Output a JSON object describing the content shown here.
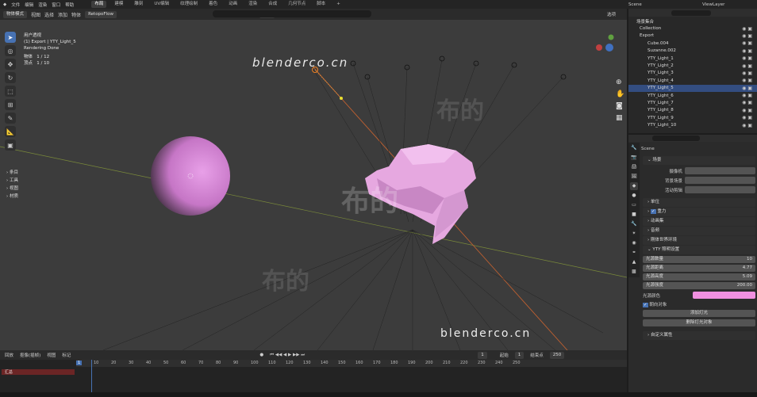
{
  "topbar": {
    "menus": [
      "文件",
      "编辑",
      "渲染",
      "窗口",
      "帮助"
    ],
    "workspaces": [
      "布局",
      "建模",
      "雕刻",
      "UV编辑",
      "纹理绘制",
      "着色",
      "动画",
      "渲染",
      "合成",
      "几何节点",
      "脚本"
    ],
    "active_workspace": "布局",
    "scene": "Scene",
    "view_layer": "ViewLayer"
  },
  "viewport_header": {
    "mode": "物体模式",
    "menus": [
      "视图",
      "选择",
      "添加",
      "物体"
    ],
    "addon": "RetopoFlow",
    "transform": "全局",
    "options": "选项"
  },
  "overlay_info": {
    "line1": "用户透视",
    "line2": "(1) Export | YTY_Light_5",
    "line3": "Rendering Done",
    "objects_label": "物体",
    "objects_value": "1 / 12",
    "verts_label": "顶点",
    "verts_value": "1 / 10"
  },
  "side_tabs": [
    "条目",
    "工具",
    "视图",
    "材质"
  ],
  "watermarks": {
    "site": "blenderco.cn",
    "cn": "布的"
  },
  "outliner": {
    "title": "场景集合",
    "rows": [
      {
        "label": "Collection",
        "indent": 0
      },
      {
        "label": "Export",
        "indent": 0
      },
      {
        "label": "Cube.004",
        "indent": 1
      },
      {
        "label": "Suzanne.002",
        "indent": 1
      },
      {
        "label": "YTY_Light_1",
        "indent": 1
      },
      {
        "label": "YTY_Light_2",
        "indent": 1
      },
      {
        "label": "YTY_Light_3",
        "indent": 1
      },
      {
        "label": "YTY_Light_4",
        "indent": 1
      },
      {
        "label": "YTY_Light_5",
        "indent": 1,
        "selected": true
      },
      {
        "label": "YTY_Light_6",
        "indent": 1
      },
      {
        "label": "YTY_Light_7",
        "indent": 1
      },
      {
        "label": "YTY_Light_8",
        "indent": 1
      },
      {
        "label": "YTY_Light_9",
        "indent": 1
      },
      {
        "label": "YTY_Light_10",
        "indent": 1
      }
    ]
  },
  "properties": {
    "scene_name": "Scene",
    "scene_section": "场景",
    "camera_label": "摄像机",
    "bg_scene_label": "背景场景",
    "active_clip_label": "活动剪辑",
    "sections": [
      "单位",
      "重力",
      "动画集",
      "音频",
      "刚体世界环境"
    ],
    "gravity_checked": true,
    "yty_panel": "YTY 照明设置",
    "fields": [
      {
        "label": "光源数量",
        "value": "10"
      },
      {
        "label": "光源距离",
        "value": "4.77"
      },
      {
        "label": "光源高度",
        "value": "5.09"
      },
      {
        "label": "光源强度",
        "value": "200.00"
      }
    ],
    "color_label": "光源颜色",
    "light_color": "#f090e0",
    "rotate_checkbox": "朝向对象",
    "rotate_checked": true,
    "btn_add": "添加灯光",
    "btn_remove": "删除灯光对象",
    "custom_props": "自定义属性"
  },
  "timeline": {
    "menus": [
      "回放",
      "抠像(插帧)",
      "视图",
      "标记"
    ],
    "current_frame": "1",
    "start_label": "起始",
    "start": "1",
    "end_label": "结束点",
    "end": "250",
    "ticks": [
      "1",
      "10",
      "20",
      "30",
      "40",
      "50",
      "60",
      "70",
      "80",
      "90",
      "100",
      "110",
      "120",
      "130",
      "140",
      "150",
      "160",
      "170",
      "180",
      "190",
      "200",
      "210",
      "220",
      "230",
      "240",
      "250"
    ],
    "track": "汇总"
  },
  "colors": {
    "accent": "#4772b3",
    "sphere": "#d884d8",
    "monkey": "#e6a8e0"
  }
}
